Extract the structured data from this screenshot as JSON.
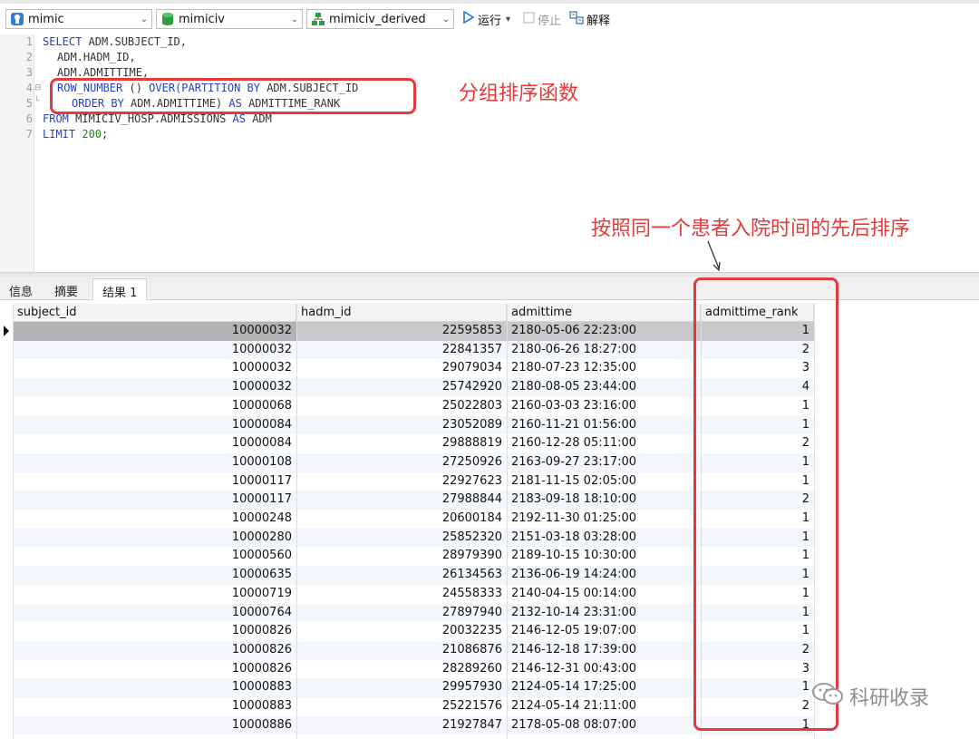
{
  "toolbar": {
    "connection": "mimic",
    "database": "mimiciv",
    "schema": "mimiciv_derived",
    "run_label": "运行",
    "run_dropdown": "▾",
    "stop_label": "停止",
    "explain_label": "解释"
  },
  "editor": {
    "lines": [
      {
        "num": "1"
      },
      {
        "num": "2"
      },
      {
        "num": "3"
      },
      {
        "num": "4"
      },
      {
        "num": "5"
      },
      {
        "num": "6"
      },
      {
        "num": "7"
      }
    ],
    "tokens": {
      "l1_kw": "SELECT",
      "l1_id": " ADM.SUBJECT_ID,",
      "l2_id": "ADM.HADM_ID,",
      "l3_id": "ADM.ADMITTIME,",
      "l4_kw1": "ROW_NUMBER",
      "l4_p": " () ",
      "l4_kw2": "OVER(",
      "l4_kw3": "PARTITION BY",
      "l4_id": " ADM.SUBJECT_ID",
      "l5_kw1": "ORDER BY",
      "l5_id1": " ADM.ADMITTIME) ",
      "l5_kw2": "AS",
      "l5_id2": " ADMITTIME_RANK",
      "l6_kw1": "FROM",
      "l6_id": " MIMICIV_HOSP.ADMISSIONS ",
      "l6_kw2": "AS",
      "l6_id2": " ADM",
      "l7_kw": "LIMIT",
      "l7_num": "200",
      "l7_end": ";"
    }
  },
  "annotations": {
    "group_sort_fn": "分组排序函数",
    "rank_note": "按照同一个患者入院时间的先后排序"
  },
  "tabs": [
    {
      "label": "信息"
    },
    {
      "label": "摘要"
    },
    {
      "label": "结果 1"
    }
  ],
  "grid": {
    "columns": [
      "subject_id",
      "hadm_id",
      "admittime",
      "admittime_rank"
    ],
    "rows": [
      [
        "10000032",
        "22595853",
        "2180-05-06 22:23:00",
        "1"
      ],
      [
        "10000032",
        "22841357",
        "2180-06-26 18:27:00",
        "2"
      ],
      [
        "10000032",
        "29079034",
        "2180-07-23 12:35:00",
        "3"
      ],
      [
        "10000032",
        "25742920",
        "2180-08-05 23:44:00",
        "4"
      ],
      [
        "10000068",
        "25022803",
        "2160-03-03 23:16:00",
        "1"
      ],
      [
        "10000084",
        "23052089",
        "2160-11-21 01:56:00",
        "1"
      ],
      [
        "10000084",
        "29888819",
        "2160-12-28 05:11:00",
        "2"
      ],
      [
        "10000108",
        "27250926",
        "2163-09-27 23:17:00",
        "1"
      ],
      [
        "10000117",
        "22927623",
        "2181-11-15 02:05:00",
        "1"
      ],
      [
        "10000117",
        "27988844",
        "2183-09-18 18:10:00",
        "2"
      ],
      [
        "10000248",
        "20600184",
        "2192-11-30 01:25:00",
        "1"
      ],
      [
        "10000280",
        "25852320",
        "2151-03-18 03:28:00",
        "1"
      ],
      [
        "10000560",
        "28979390",
        "2189-10-15 10:30:00",
        "1"
      ],
      [
        "10000635",
        "26134563",
        "2136-06-19 14:24:00",
        "1"
      ],
      [
        "10000719",
        "24558333",
        "2140-04-15 00:14:00",
        "1"
      ],
      [
        "10000764",
        "27897940",
        "2132-10-14 23:31:00",
        "1"
      ],
      [
        "10000826",
        "20032235",
        "2146-12-05 19:07:00",
        "1"
      ],
      [
        "10000826",
        "21086876",
        "2146-12-18 17:39:00",
        "2"
      ],
      [
        "10000826",
        "28289260",
        "2146-12-31 00:43:00",
        "3"
      ],
      [
        "10000883",
        "29957930",
        "2124-05-14 17:25:00",
        "1"
      ],
      [
        "10000883",
        "25221576",
        "2124-05-14 21:11:00",
        "2"
      ],
      [
        "10000886",
        "21927847",
        "2178-05-08 08:07:00",
        "1"
      ]
    ]
  },
  "watermark": "科研收录",
  "colors": {
    "annotation": "#e33b3b",
    "keyword": "#2440c8",
    "number": "#1a8a1a",
    "selected_row": "#c9c9c9"
  },
  "icons": {
    "connection": "plug-icon",
    "database": "database-icon",
    "schema": "schema-icon",
    "run": "play-icon",
    "stop": "stop-icon",
    "explain": "explain-icon"
  }
}
